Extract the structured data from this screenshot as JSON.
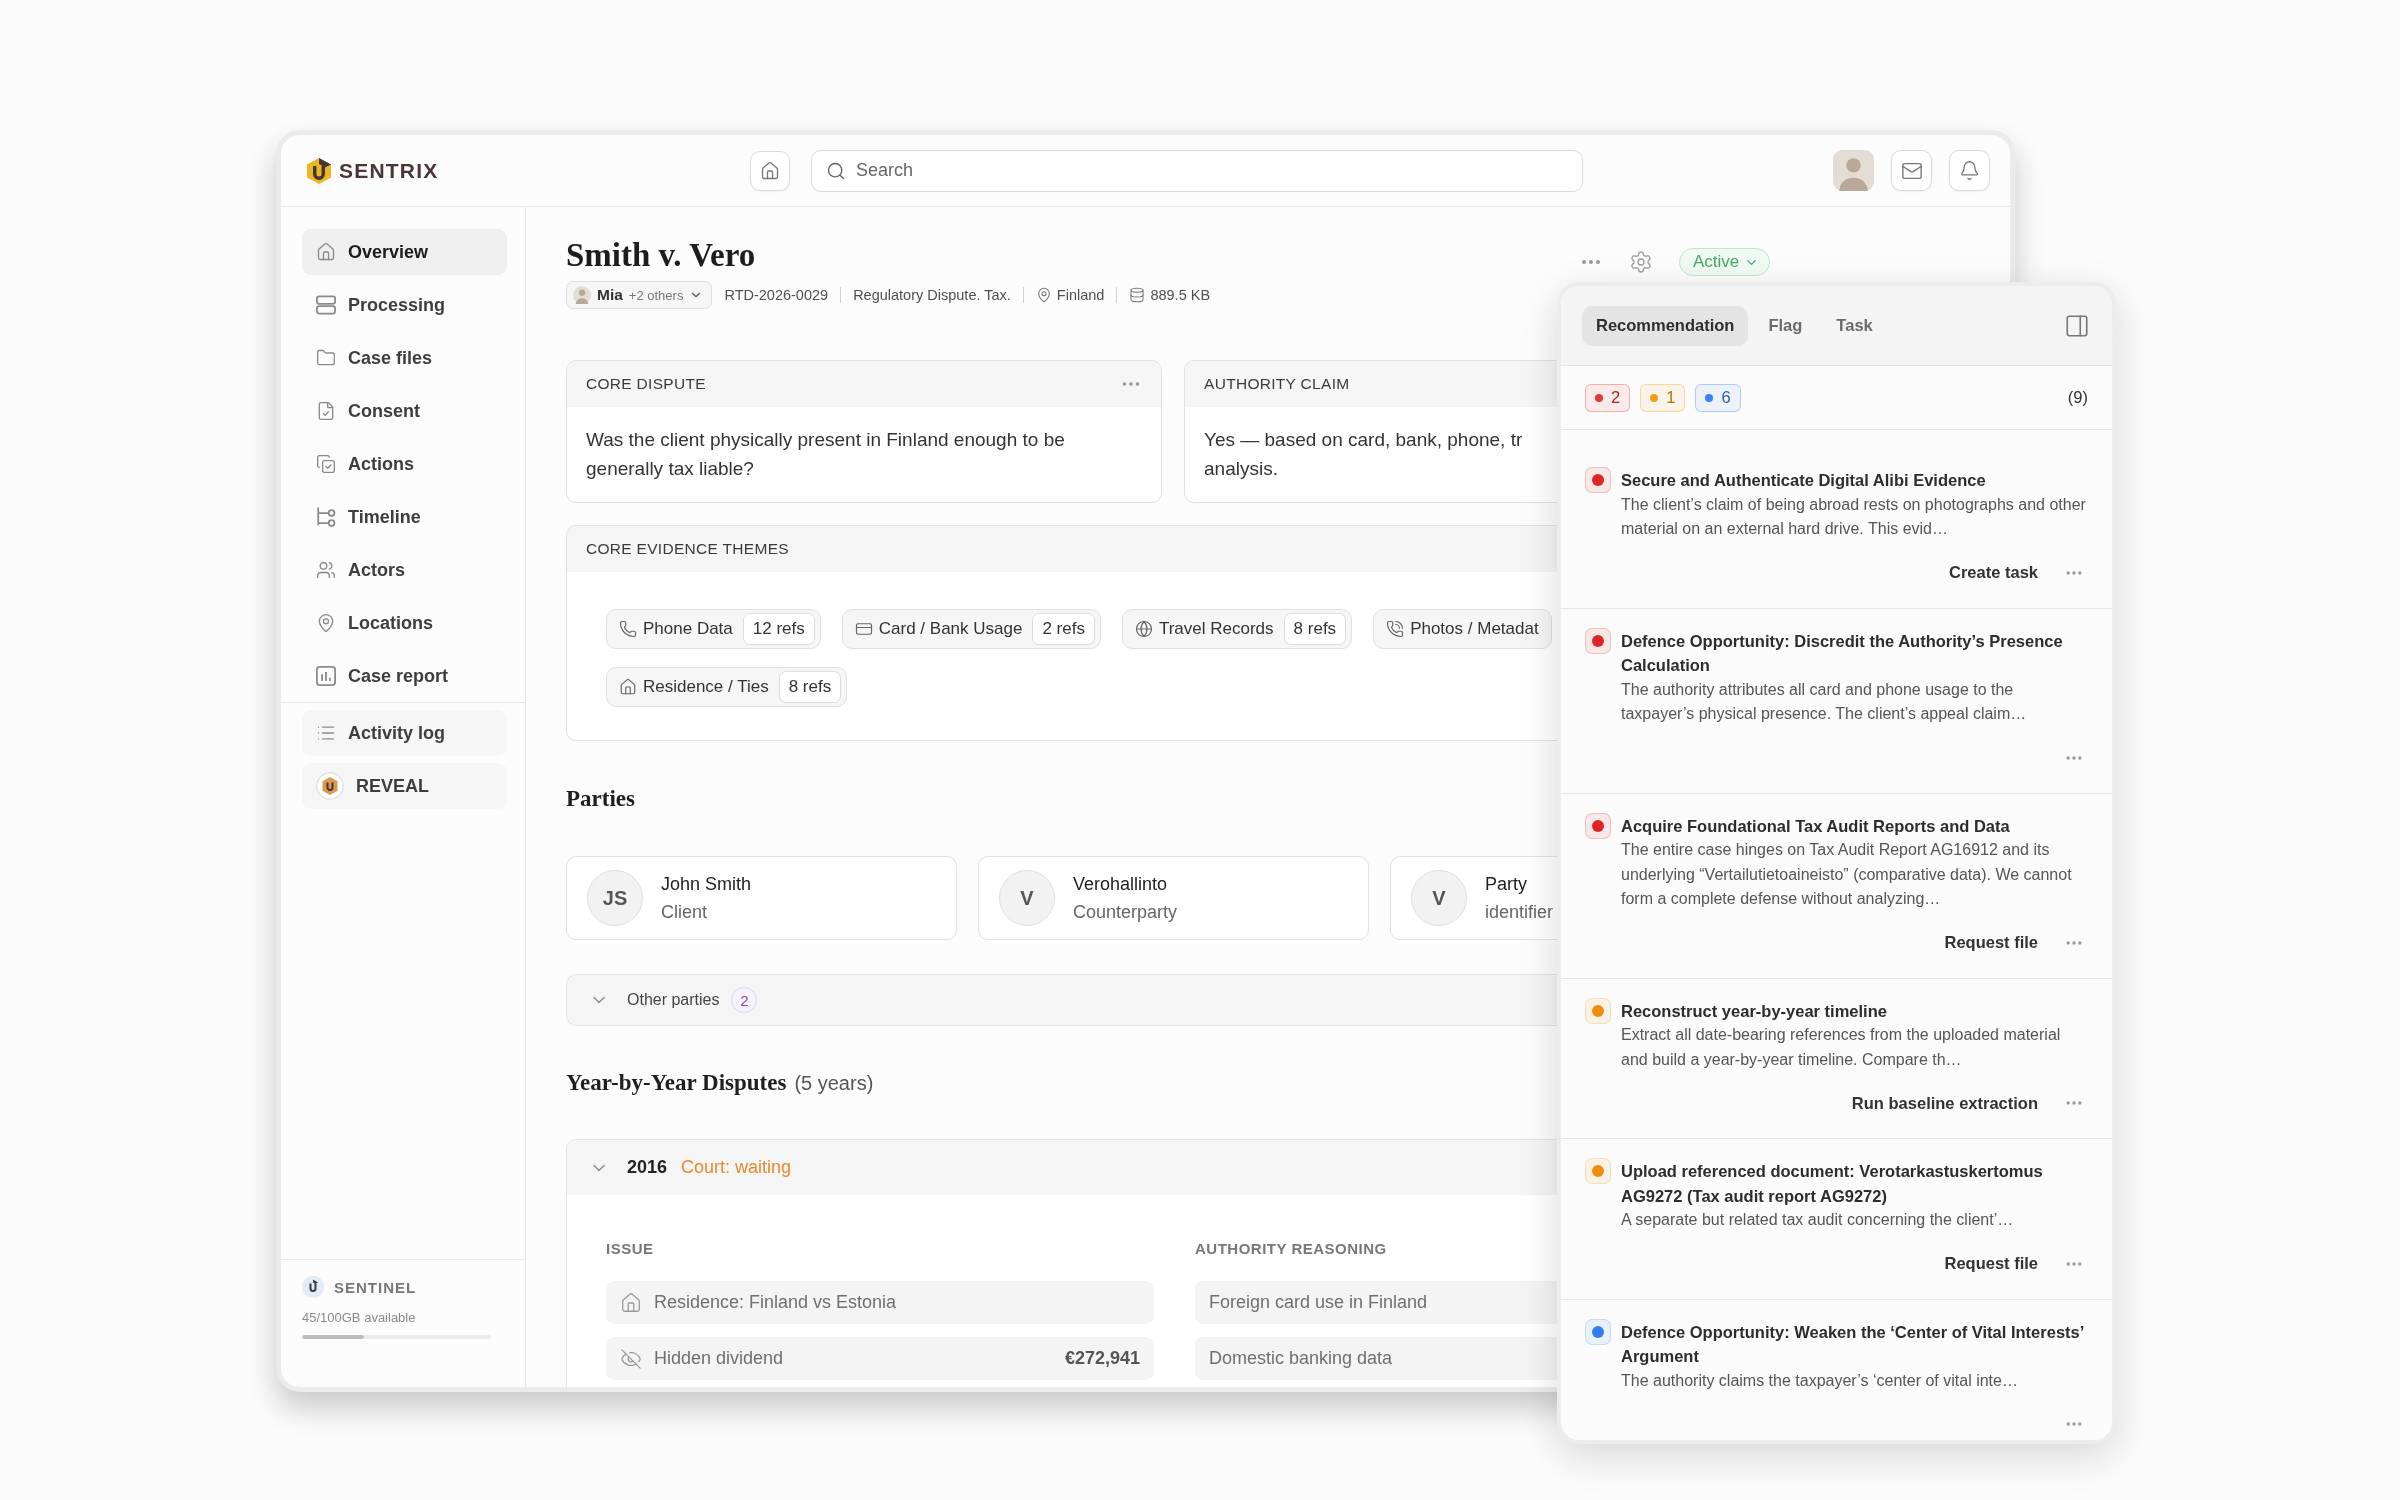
{
  "topbar": {
    "brand": "SENTRIX",
    "search": {
      "placeholder": "Search"
    }
  },
  "sidebar": {
    "items": [
      {
        "label": "Overview",
        "selected": true
      },
      {
        "label": "Processing",
        "selected": false
      },
      {
        "label": "Case files",
        "selected": false
      },
      {
        "label": "Consent",
        "selected": false
      },
      {
        "label": "Actions",
        "selected": false
      },
      {
        "label": "Timeline",
        "selected": false
      },
      {
        "label": "Actors",
        "selected": false
      },
      {
        "label": "Locations",
        "selected": false
      },
      {
        "label": "Case report",
        "selected": false
      }
    ],
    "tools": [
      {
        "label": "Activity log",
        "selected": false
      },
      {
        "label": "REVEAL",
        "selected": false
      }
    ],
    "footer": {
      "brand": "SENTINEL",
      "storage": "45/100GB available",
      "level": 0.33
    }
  },
  "case": {
    "title": "Smith v. Vero",
    "owner": {
      "name": "Mia",
      "others": "+2 others"
    },
    "meta": [
      {
        "kind": "id",
        "text": "RTD-2026-0029"
      },
      {
        "kind": "category",
        "text": "Regulatory Dispute. Tax."
      },
      {
        "kind": "location",
        "text": "Finland"
      },
      {
        "kind": "size",
        "text": "889.5 KB"
      }
    ],
    "status": "Active"
  },
  "summary_cards": [
    {
      "heading": "CORE DISPUTE",
      "text": "Was the client physically present in Finland enough to be generally tax liable?",
      "menu": true
    },
    {
      "heading": "AUTHORITY CLAIM",
      "text": "Yes — based on card, bank, phone, tr\nanalysis."
    }
  ],
  "evidence_themes": {
    "heading": "CORE EVIDENCE THEMES",
    "themes": [
      {
        "label": "Phone Data",
        "count": "12 refs"
      },
      {
        "label": "Card / Bank Usage",
        "count": "2 refs"
      },
      {
        "label": "Travel Records",
        "count": "8 refs"
      },
      {
        "label": "Photos / Metadat"
      },
      {
        "label": "Residence / Ties",
        "count": "8 refs"
      }
    ]
  },
  "parties": {
    "heading": "Parties",
    "cards": [
      {
        "initials": "JS",
        "name": "John Smith",
        "role": "Client"
      },
      {
        "initials": "V",
        "name": "Verohallinto",
        "role": "Counterparty"
      },
      {
        "initials": "V",
        "name": "Party",
        "role": "identifier"
      }
    ],
    "other": {
      "label": "Other parties",
      "count": "2"
    }
  },
  "disputes": {
    "heading": "Year-by-Year Disputes",
    "count": "(5 years)",
    "years": [
      {
        "year": "2016",
        "status": "Court: waiting",
        "expanded": true,
        "columns": [
          "ISSUE",
          "AUTHORITY REASONING"
        ],
        "issues": [
          {
            "issue": "Residence: Finland vs Estonia"
          },
          {
            "issue": "Hidden dividend",
            "amount": "€272,941"
          }
        ],
        "reasoning": [
          "Foreign card use in Finland",
          "Domestic banking data"
        ]
      }
    ]
  },
  "panel": {
    "tabs": [
      {
        "label": "Recommendation",
        "selected": true
      },
      {
        "label": "Flag",
        "selected": false
      },
      {
        "label": "Task",
        "selected": false
      }
    ],
    "filters": [
      {
        "count": "2",
        "color": "#e53935"
      },
      {
        "count": "1",
        "color": "#f59e0b"
      },
      {
        "count": "6",
        "color": "#3b82f6"
      }
    ],
    "total": "(9)",
    "items": [
      {
        "color": "#dc2626",
        "title": "Secure and Authenticate Digital Alibi Evidence",
        "text": "The client’s claim of being abroad rests on photographs and other material on an external hard drive. This evid…",
        "action": "Create task"
      },
      {
        "color": "#dc2626",
        "title": "Defence Opportunity: Discredit the Authority’s Presence Calculation",
        "text": "The authority attributes all card and phone usage to the taxpayer’s physical presence. The client’s appeal claim…"
      },
      {
        "color": "#dc2626",
        "title": "Acquire Foundational Tax Audit Reports and Data",
        "text": "The entire case hinges on Tax Audit Report AG16912 and its underlying “Vertailutietoaineisto” (comparative data). We cannot form a complete defense without analyzing…",
        "action": "Request file"
      },
      {
        "color": "#f28c0f",
        "title": "Reconstruct year-by-year timeline",
        "text": "Extract all date-bearing references from the uploaded material and build a year-by-year timeline. Compare th…",
        "action": "Run baseline extraction"
      },
      {
        "color": "#f28c0f",
        "title": "Upload referenced document: Verotarkastuskertomus AG9272 (Tax audit report AG9272)",
        "text": "A separate but related tax audit concerning the client’…",
        "action": "Request file"
      },
      {
        "color": "#2f80ed",
        "title": "Defence Opportunity: Weaken the ‘Center of Vital Interests’ Argument",
        "text": "The authority claims the taxpayer’s ‘center of vital inte…"
      }
    ]
  }
}
